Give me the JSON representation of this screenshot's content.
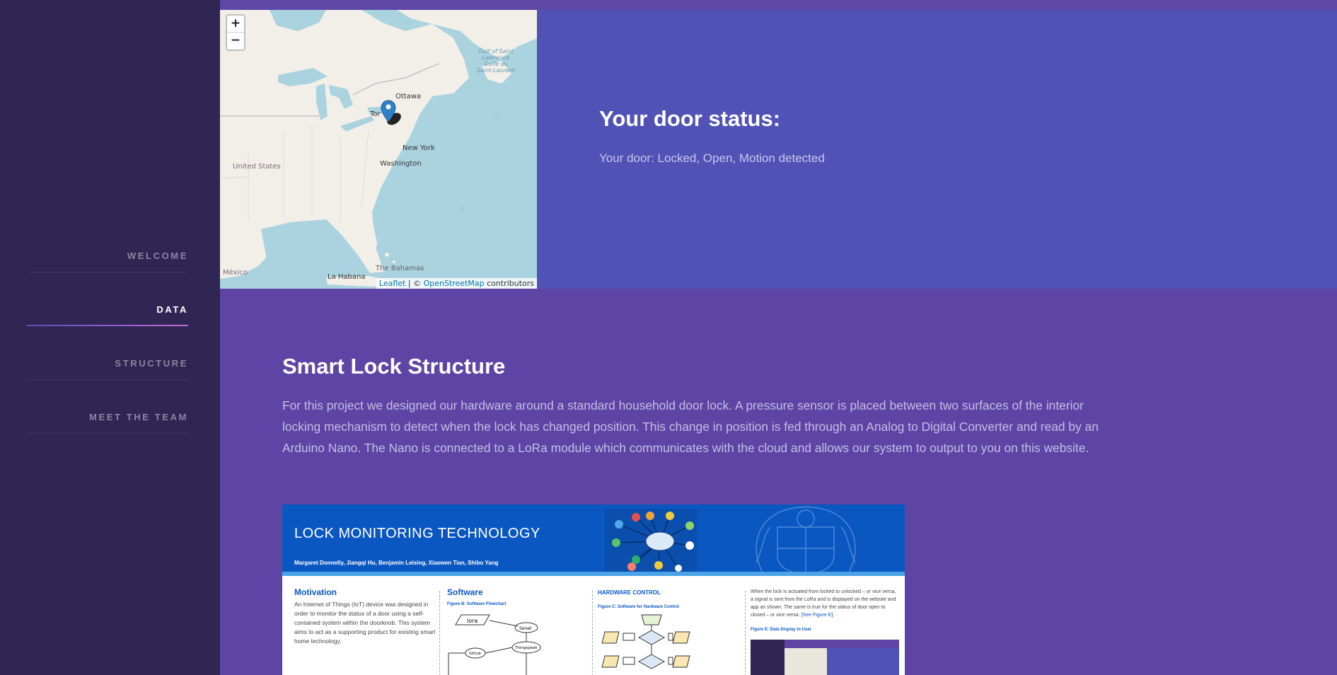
{
  "sidebar": {
    "items": [
      {
        "label": "WELCOME",
        "active": false
      },
      {
        "label": "DATA",
        "active": true
      },
      {
        "label": "STRUCTURE",
        "active": false
      },
      {
        "label": "MEET THE TEAM",
        "active": false
      }
    ]
  },
  "map": {
    "zoom_in": "+",
    "zoom_out": "−",
    "labels": {
      "ottawa": "Ottawa",
      "toronto": "Tor",
      "new_york": "New York",
      "washington": "Washington",
      "united_states": "United States",
      "mexico": "México",
      "la_habana": "La Habana",
      "bahamas": "The Bahamas",
      "gulf": "Gulf of Saint Lawrence Golfe du Saint-Laurent"
    },
    "attribution": {
      "leaflet": "Leaflet",
      "separator": " | © ",
      "osm": "OpenStreetMap",
      "suffix": " contributors"
    },
    "marker_icon": "map-marker-icon"
  },
  "door": {
    "title": "Your door status:",
    "status_text": "Your door: Locked, Open, Motion detected"
  },
  "structure": {
    "title": "Smart Lock Structure",
    "description": "For this project we designed our hardware around a standard household door lock. A pressure sensor is placed between two surfaces of the interior locking mechanism to detect when the lock has changed position. This change in position is fed through an Analog to Digital Converter and read by an Arduino Nano. The Nano is connected to a LoRa module which communicates with the cloud and allows our system to output to you on this website."
  },
  "poster": {
    "title": "LOCK MONITORING TECHNOLOGY",
    "authors": "Margaret Donnelly, Jiangqi Hu, Benjamin Leising, Xiaowen Tian, Shibo Yang",
    "motivation_heading": "Motivation",
    "motivation_text": "An Internet of Things (IoT) device was designed in order to monitor the status of a door using a self-contained system within the doorknob. This system aims to act as a supporting product for existing smart home technology.",
    "software_heading": "Software",
    "software_fig": "Figure B: Software Flowchart",
    "hardware_heading": "HARDWARE CONTROL",
    "hardware_fig": "Figure C: Software for Hardware Control",
    "status_text": "When the lock is actuated from locked to unlocked – or vice versa, a signal is sent from the LoRa and is displayed on the website and app as shown. The same is true for the status of door open to closed – or vice versa.",
    "status_link": "[See Figure E].",
    "display_fig": "Figure E: Data Display to User",
    "flow_lora": "lora",
    "flow_senet": "Senet",
    "flow_thingspeak": "Thingspeak",
    "flow_github": "Github"
  }
}
